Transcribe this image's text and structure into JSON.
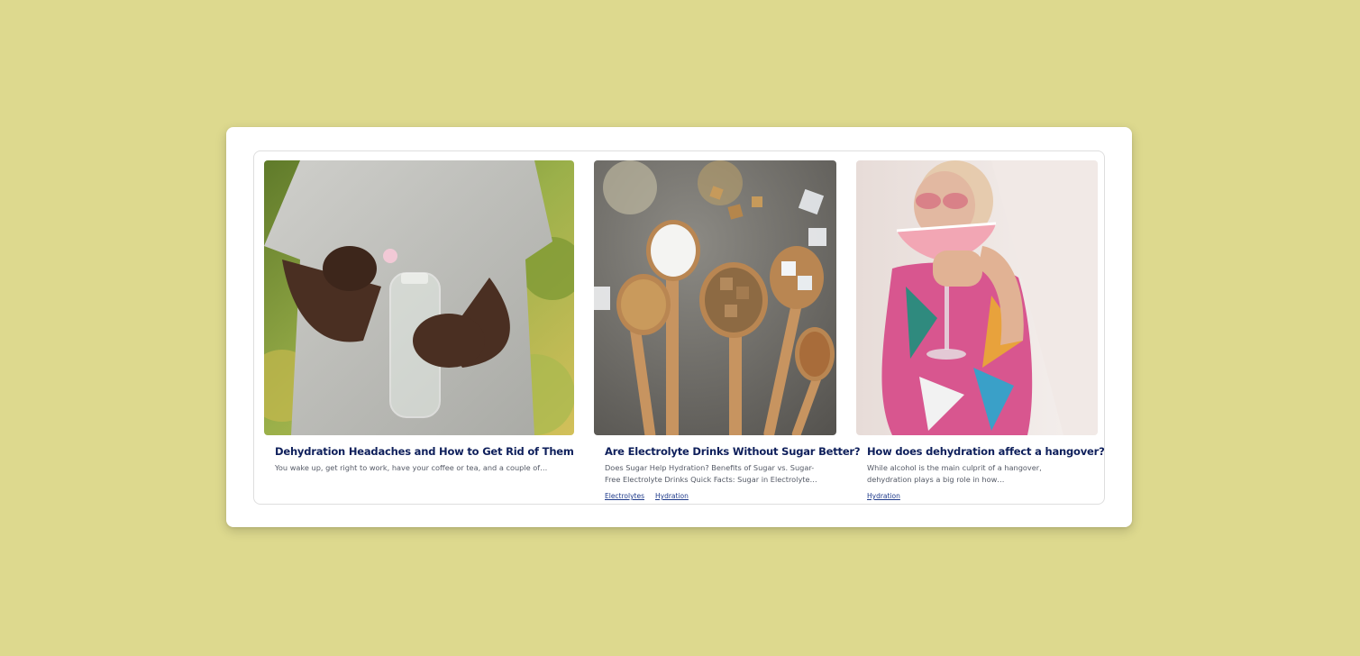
{
  "colors": {
    "page_background": "#ddd98e",
    "card_background": "#ffffff",
    "title_color": "#0e1f5b",
    "excerpt_color": "#555a66",
    "tag_color": "#1e3a8a"
  },
  "articles": [
    {
      "title": "Dehydration Headaches and How to Get Rid of Them",
      "excerpt": "You wake up, get right to work, have your coffee or tea, and a couple of…",
      "image": "photo-person-dropping-tablet-into-water-bottle",
      "tags": []
    },
    {
      "title": "Are Electrolyte Drinks Without Sugar Better?",
      "excerpt": "Does Sugar Help Hydration? Benefits of Sugar vs. Sugar-Free Electrolyte Drinks Quick Facts: Sugar in Electrolyte…",
      "image": "photo-wooden-spoons-with-sugars",
      "tags": [
        "Electrolytes",
        "Hydration"
      ]
    },
    {
      "title": "How does dehydration affect a hangover?",
      "excerpt": "While alcohol is the main culprit of a hangover, dehydration plays a big role in how…",
      "image": "photo-woman-holding-pink-cocktail",
      "tags": [
        "Hydration"
      ]
    }
  ]
}
